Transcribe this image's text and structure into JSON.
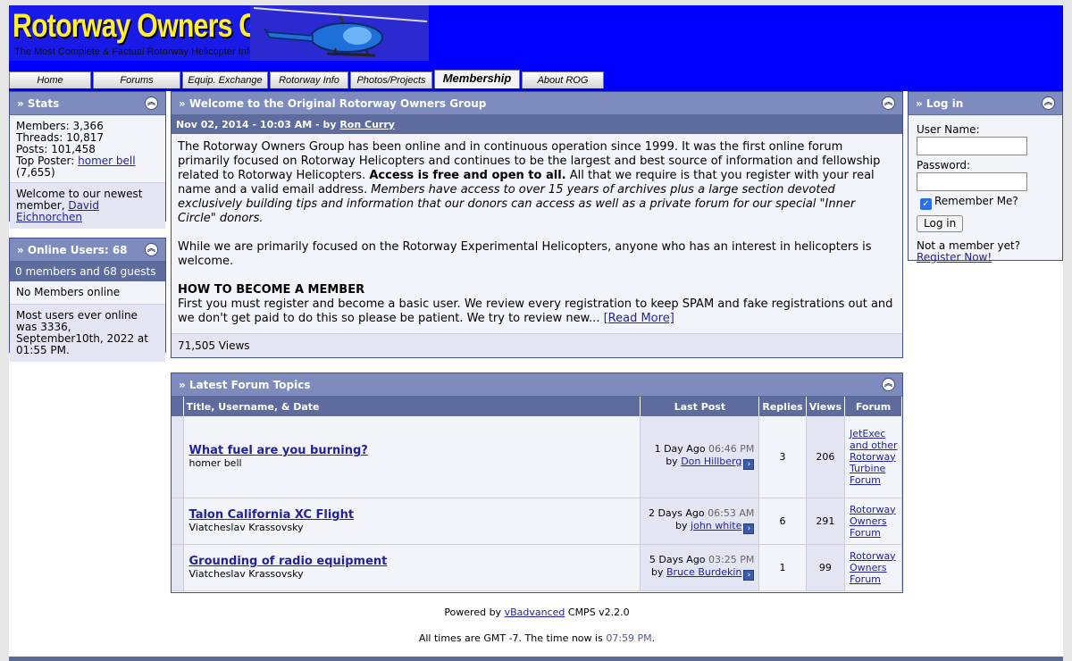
{
  "banner": {
    "title": "Rotorway Owners Group",
    "subtitle": "The Most Complete & Factual Rotorway Helicopter Info"
  },
  "nav": [
    {
      "label": "Home",
      "active": false
    },
    {
      "label": "Forums",
      "active": false
    },
    {
      "label": "Equip. Exchange",
      "active": false
    },
    {
      "label": "Rotorway Info",
      "active": false
    },
    {
      "label": "Photos/Projects",
      "active": false
    },
    {
      "label": "Membership",
      "active": true
    },
    {
      "label": "About ROG",
      "active": false
    }
  ],
  "stats": {
    "title": "» Stats",
    "members": "Members: 3,366",
    "threads": "Threads: 10,817",
    "posts": "Posts: 101,458",
    "top_poster_label": "Top Poster: ",
    "top_poster_name": "homer bell",
    "top_poster_count": "(7,655)",
    "newest_text": "Welcome to our newest member, ",
    "newest_member": "David Eichnorchen"
  },
  "online": {
    "title": "» Online Users: 68",
    "summary": "0 members and 68 guests",
    "none": "No Members online",
    "record": "Most users ever online was 3336, September10th, 2022 at 01:55 PM."
  },
  "article": {
    "title": "» Welcome to the Original Rotorway Owners Group",
    "meta_date": "Nov 02, 2014 - 10:03 AM - by ",
    "meta_author": "Ron Curry",
    "p1_a": "The Rotorway Owners Group has been online and in continuous operation since 1999. It was the first online forum primarily focused on Rotorway Helicopters and continues to be the largest and best source of information and fellowship related to Rotorway Helicopters. ",
    "p1_bold": "Access is free and open to all.",
    "p1_b": " All that we require is that you register with your real name and a valid email address. ",
    "p1_italic": "Members have access to over 15 years of archives plus a large section devoted exclusively building tips and information that our donors can access as well as a private forum for our special \"Inner Circle\" donors.",
    "p2": "While we are primarily focused on the Rotorway Experimental Helicopters, anyone who has an interest in helicopters is welcome.",
    "h3": "HOW TO BECOME A MEMBER",
    "p3": "First you must register and become a basic user. We review every registration to keep SPAM and fake registrations out and we don't get paid to do this so please be patient. We try to review new... ",
    "read_more": "[Read More]",
    "views": "71,505 Views"
  },
  "login": {
    "title": "» Log in",
    "username_label": "User Name:",
    "password_label": "Password:",
    "remember": "Remember Me?",
    "button": "Log in",
    "not_member": "Not a member yet?",
    "register": "Register Now!"
  },
  "topics": {
    "title": "» Latest Forum Topics",
    "headers": {
      "title": "Title, Username, & Date",
      "last": "Last Post",
      "replies": "Replies",
      "views": "Views",
      "forum": "Forum"
    },
    "rows": [
      {
        "title": "What fuel are you burning?",
        "user": "homer bell",
        "last_day": "1 Day Ago",
        "last_time": "06:46 PM",
        "last_by": "by ",
        "last_user": "Don Hillberg",
        "replies": "3",
        "views": "206",
        "forum": "JetExec and other Rotorway Turbine Forum"
      },
      {
        "title": "Talon California XC Flight",
        "user": "Viatcheslav Krassovsky",
        "last_day": "2 Days Ago",
        "last_time": "06:53 AM",
        "last_by": "by ",
        "last_user": "john white",
        "replies": "6",
        "views": "291",
        "forum": "Rotorway Owners Forum"
      },
      {
        "title": "Grounding of radio equipment",
        "user": "Viatcheslav Krassovsky",
        "last_day": "5 Days Ago",
        "last_time": "03:25 PM",
        "last_by": "by ",
        "last_user": "Bruce Burdekin",
        "replies": "1",
        "views": "99",
        "forum": "Rotorway Owners Forum"
      }
    ]
  },
  "footer": {
    "powered_a": "Powered by ",
    "powered_link": "vBadvanced",
    "powered_b": " CMPS v2.2.0",
    "times_a": "All times are GMT -7. The time now is ",
    "time_now": "07:59 PM",
    "times_b": "."
  }
}
